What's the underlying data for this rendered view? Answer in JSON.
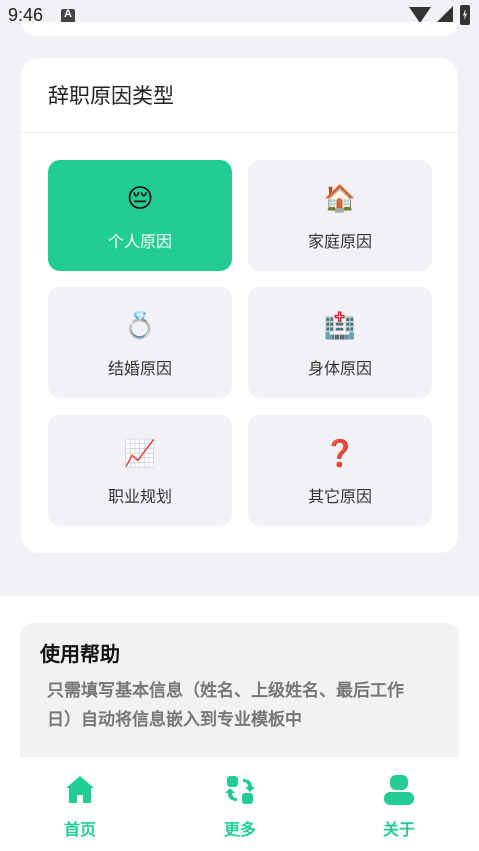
{
  "status_bar": {
    "time": "9:46"
  },
  "card": {
    "title": "辞职原因类型",
    "options": [
      {
        "emoji": "😔",
        "label": "个人原因",
        "selected": true
      },
      {
        "emoji": "🏠",
        "label": "家庭原因",
        "selected": false
      },
      {
        "emoji": "💍",
        "label": "结婚原因",
        "selected": false
      },
      {
        "emoji": "🏥",
        "label": "身体原因",
        "selected": false
      },
      {
        "emoji": "📈",
        "label": "职业规划",
        "selected": false
      },
      {
        "emoji": "❓",
        "label": "其它原因",
        "selected": false
      }
    ]
  },
  "help": {
    "title": "使用帮助",
    "text": "只需填写基本信息（姓名、上级姓名、最后工作日）自动将信息嵌入到专业模板中"
  },
  "tabbar": {
    "items": [
      {
        "label": "首页",
        "icon": "home-icon"
      },
      {
        "label": "更多",
        "icon": "swap-icon"
      },
      {
        "label": "关于",
        "icon": "user-icon"
      }
    ]
  },
  "colors": {
    "accent": "#22cd94",
    "background": "#f2f1f6",
    "tile": "#f2f1f6"
  }
}
